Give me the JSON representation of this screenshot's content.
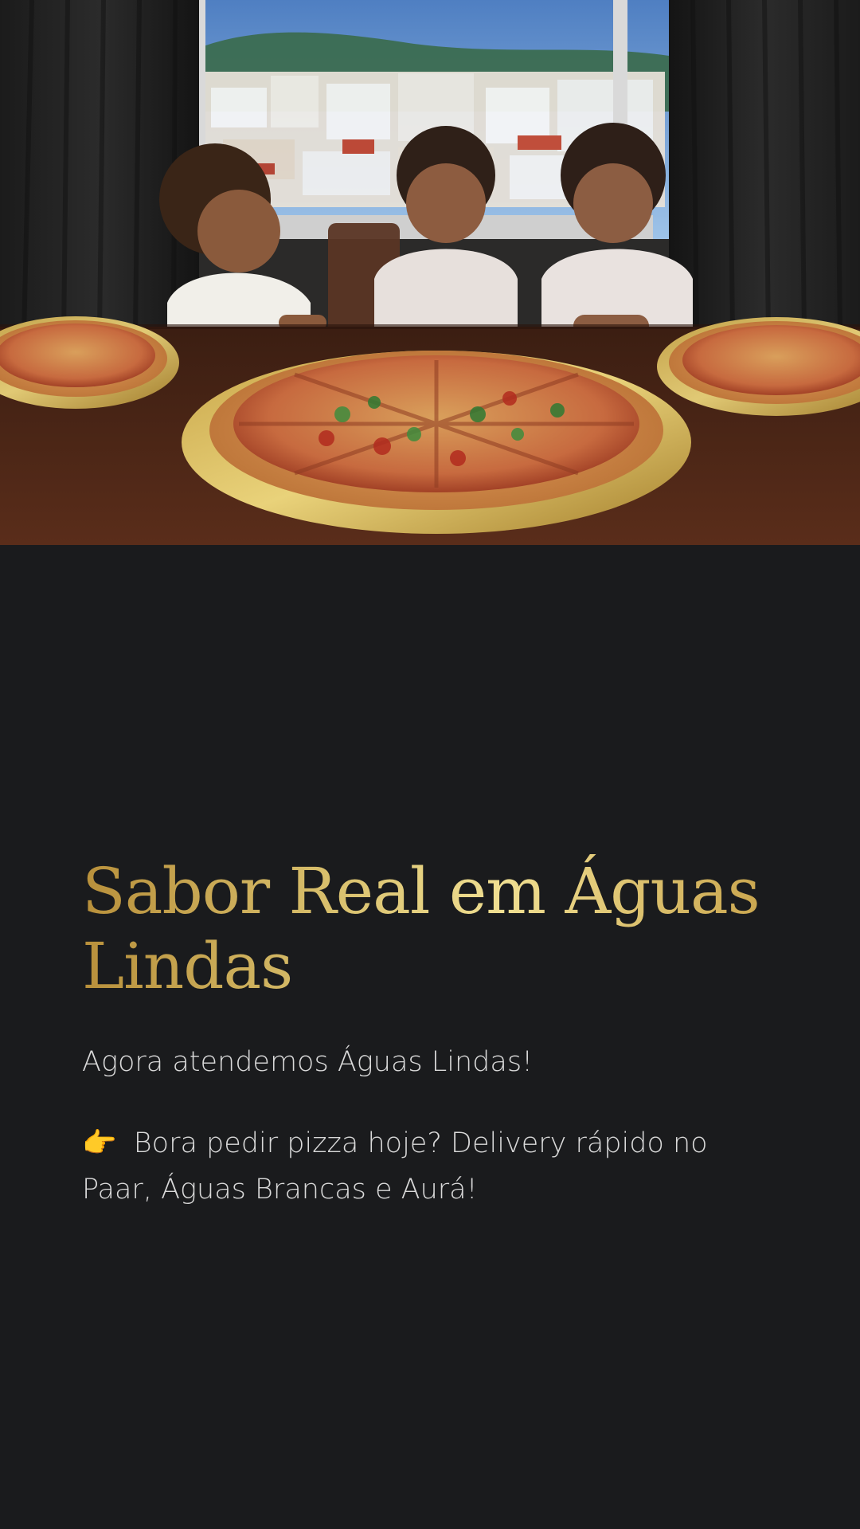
{
  "hero": {
    "image_semantic": "children-with-pizzas-photo"
  },
  "content": {
    "title": "Sabor Real em Águas Lindas",
    "subtitle": "Agora atendemos Águas Lindas!",
    "cta_emoji": "👉",
    "cta_text": "Bora pedir pizza hoje? Delivery rápido no Paar, Águas Brancas e Aurá!"
  },
  "colors": {
    "background": "#1a1b1d",
    "title_gold": "#d8bf6c",
    "body_text": "#d9d9d9"
  }
}
